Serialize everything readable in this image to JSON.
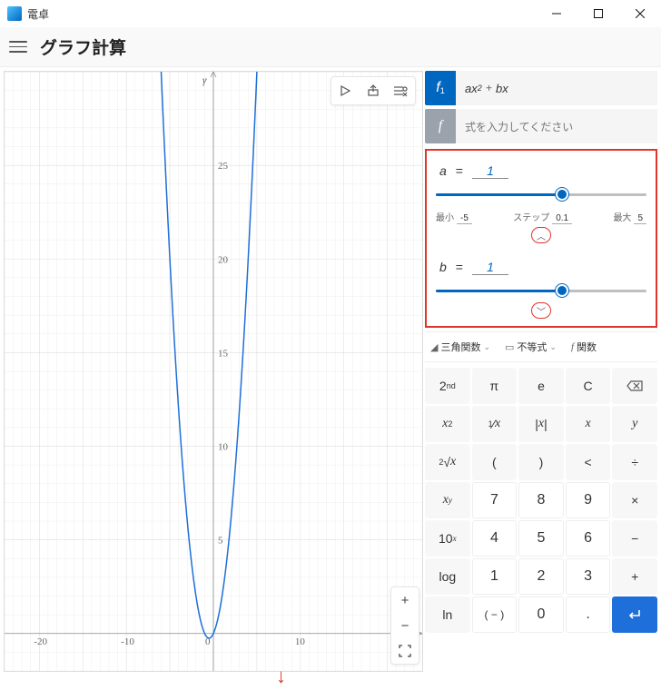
{
  "app": {
    "title": "電卓"
  },
  "header": {
    "title": "グラフ計算"
  },
  "chart_data": {
    "type": "line",
    "title": "",
    "xlabel": "",
    "ylabel": "y",
    "xlim": [
      -24,
      24
    ],
    "ylim": [
      -2,
      30
    ],
    "x_ticks": [
      -20,
      -10,
      0,
      10
    ],
    "y_ticks": [
      5,
      10,
      15,
      20,
      25
    ],
    "series": [
      {
        "name": "ax^2 + bx",
        "a": 1,
        "b": 1,
        "x": [
          -6,
          -5.5,
          -5,
          -4.5,
          -4,
          -3.5,
          -3,
          -2.5,
          -2,
          -1.5,
          -1,
          -0.5,
          0,
          0.5,
          1,
          1.5,
          2,
          2.5,
          3,
          3.5,
          4,
          4.5,
          5
        ],
        "y": [
          30,
          24.75,
          20,
          15.75,
          12,
          8.75,
          6,
          3.75,
          2,
          0.75,
          0,
          -0.25,
          0,
          0.75,
          2,
          3.75,
          6,
          8.75,
          12,
          15.75,
          20,
          24.75,
          30
        ]
      }
    ]
  },
  "equations": {
    "f1": {
      "badge": "f",
      "sub": "1",
      "text": "ax² + bx"
    },
    "fnew": {
      "badge": "f",
      "placeholder": "式を入力してください"
    }
  },
  "vars": {
    "a": {
      "name": "a",
      "eq": "=",
      "value": "1",
      "min_label": "最小",
      "min": "-5",
      "step_label": "ステップ",
      "step": "0.1",
      "max_label": "最大",
      "max": "5",
      "fill_pct": 60
    },
    "b": {
      "name": "b",
      "eq": "=",
      "value": "1",
      "fill_pct": 60
    }
  },
  "func_cats": {
    "trig": "三角関数",
    "ineq": "不等式",
    "func": "関数"
  },
  "keypad": [
    [
      "2nd",
      "π",
      "e",
      "C",
      "⌫"
    ],
    [
      "x²",
      "¹⁄x",
      "|x|",
      "x",
      "y"
    ],
    [
      "²√x",
      "(",
      ")",
      "<",
      "÷"
    ],
    [
      "xʸ",
      "7",
      "8",
      "9",
      "×"
    ],
    [
      "10ˣ",
      "4",
      "5",
      "6",
      "−"
    ],
    [
      "log",
      "1",
      "2",
      "3",
      "+"
    ],
    [
      "ln",
      "(−)",
      "0",
      ".",
      "↵"
    ]
  ],
  "zoom": {
    "in": "+",
    "out": "−",
    "fit": "⛶"
  },
  "graph_tools": {
    "trace": "▷",
    "share": "⇪",
    "options": "✎"
  }
}
